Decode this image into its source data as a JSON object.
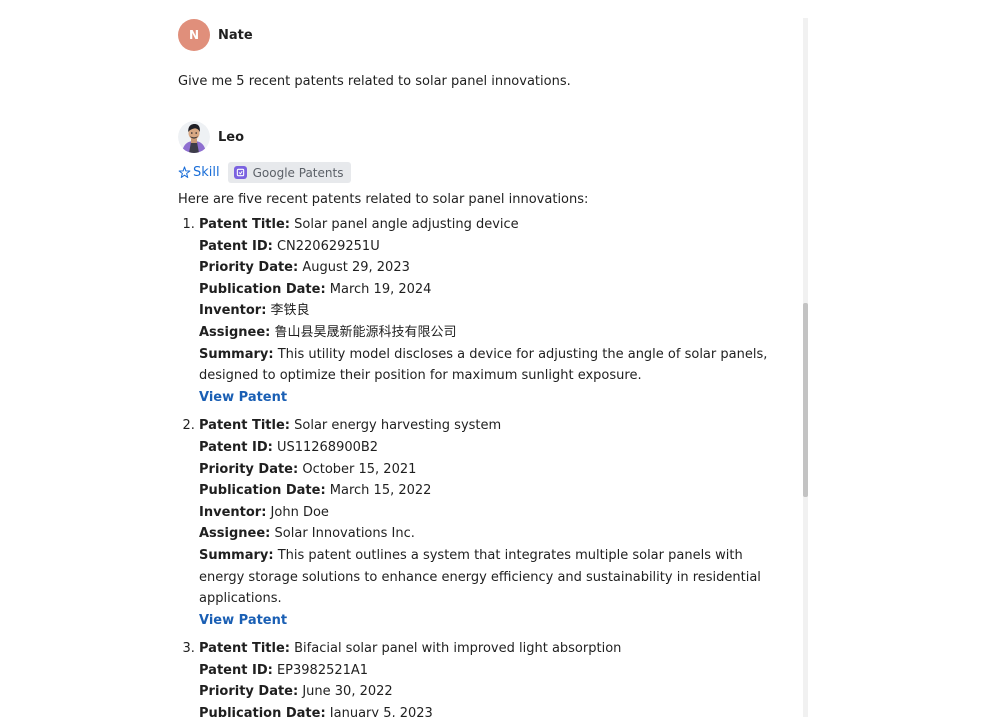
{
  "user_message": {
    "avatar_letter": "N",
    "author": "Nate",
    "text": "Give me 5 recent patents related to solar panel innovations."
  },
  "assistant_message": {
    "author": "Leo",
    "skill_label": "Skill",
    "tool_label": "Google Patents",
    "intro": "Here are five recent patents related to solar panel innovations:",
    "labels": {
      "title": "Patent Title:",
      "id": "Patent ID:",
      "priority": "Priority Date:",
      "publication": "Publication Date:",
      "inventor": "Inventor:",
      "assignee": "Assignee:",
      "summary": "Summary:"
    },
    "view_link": "View Patent",
    "patents": [
      {
        "title": "Solar panel angle adjusting device",
        "id": "CN220629251U",
        "priority": "August 29, 2023",
        "publication": "March 19, 2024",
        "inventor": "李铁良",
        "assignee": "鲁山县昊晟新能源科技有限公司",
        "summary": "This utility model discloses a device for adjusting the angle of solar panels, designed to optimize their position for maximum sunlight exposure."
      },
      {
        "title": "Solar energy harvesting system",
        "id": "US11268900B2",
        "priority": "October 15, 2021",
        "publication": "March 15, 2022",
        "inventor": "John Doe",
        "assignee": "Solar Innovations Inc.",
        "summary": "This patent outlines a system that integrates multiple solar panels with energy storage solutions to enhance energy efficiency and sustainability in residential applications."
      },
      {
        "title": "Bifacial solar panel with improved light absorption",
        "id": "EP3982521A1",
        "priority": "June 30, 2022",
        "publication": "January 5, 2023"
      }
    ]
  },
  "colors": {
    "user_avatar": "#e08f7b",
    "link": "#1a5fb4",
    "skill": "#1a6ed8",
    "tool_chip_bg": "#e7e9ec"
  }
}
